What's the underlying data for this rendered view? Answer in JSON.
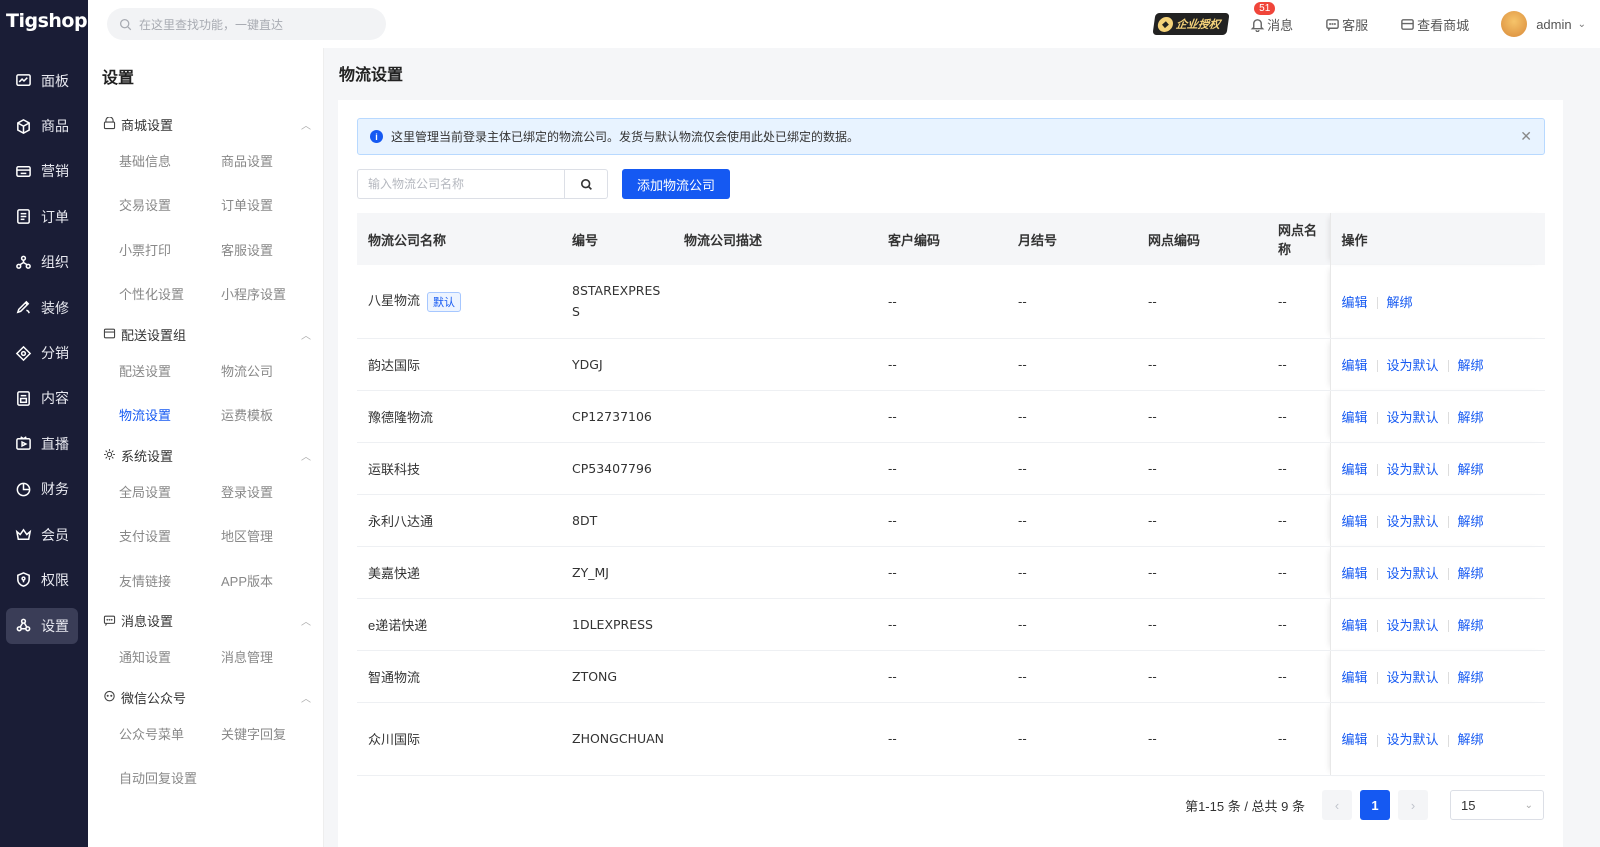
{
  "brand": "Tigshop",
  "nav": [
    {
      "label": "面板",
      "icon": "dashboard-icon"
    },
    {
      "label": "商品",
      "icon": "box-icon"
    },
    {
      "label": "营销",
      "icon": "marketing-icon"
    },
    {
      "label": "订单",
      "icon": "order-icon"
    },
    {
      "label": "组织",
      "icon": "org-icon"
    },
    {
      "label": "装修",
      "icon": "decorate-icon"
    },
    {
      "label": "分销",
      "icon": "distribution-icon"
    },
    {
      "label": "内容",
      "icon": "content-icon"
    },
    {
      "label": "直播",
      "icon": "live-icon"
    },
    {
      "label": "财务",
      "icon": "finance-icon"
    },
    {
      "label": "会员",
      "icon": "member-icon"
    },
    {
      "label": "权限",
      "icon": "permission-icon"
    },
    {
      "label": "设置",
      "icon": "settings-icon",
      "active": true
    }
  ],
  "topbar": {
    "search_placeholder": "在这里查找功能，一键直达",
    "auth_badge": "企业授权",
    "messages_label": "消息",
    "messages_count": "51",
    "service_label": "客服",
    "shop_label": "查看商城",
    "username": "admin"
  },
  "submenu": {
    "title": "设置",
    "groups": [
      {
        "label": "商城设置",
        "items": [
          "基础信息",
          "商品设置",
          "交易设置",
          "订单设置",
          "小票打印",
          "客服设置",
          "个性化设置",
          "小程序设置"
        ]
      },
      {
        "label": "配送设置组",
        "items": [
          "配送设置",
          "物流公司",
          "物流设置",
          "运费模板"
        ],
        "active": "物流设置"
      },
      {
        "label": "系统设置",
        "items": [
          "全局设置",
          "登录设置",
          "支付设置",
          "地区管理",
          "友情链接",
          "APP版本"
        ]
      },
      {
        "label": "消息设置",
        "items": [
          "通知设置",
          "消息管理"
        ]
      },
      {
        "label": "微信公众号",
        "items": [
          "公众号菜单",
          "关键字回复",
          "自动回复设置"
        ]
      }
    ]
  },
  "page": {
    "title": "物流设置",
    "alert": "这里管理当前登录主体已绑定的物流公司。发货与默认物流仅会使用此处已绑定的数据。",
    "keyword_placeholder": "输入物流公司名称",
    "add_button": "添加物流公司"
  },
  "table": {
    "columns": [
      "物流公司名称",
      "编号",
      "物流公司描述",
      "客户编码",
      "月结号",
      "网点编码",
      "网点名称",
      "操作"
    ],
    "default_tag": "默认",
    "actions": {
      "edit": "编辑",
      "set_default": "设为默认",
      "unbind": "解绑"
    },
    "rows": [
      {
        "name": "八星物流",
        "code": "8STAREXPRESS",
        "desc": "",
        "customer": "--",
        "monthly": "--",
        "site_code": "--",
        "site_name": "--",
        "is_default": true
      },
      {
        "name": "韵达国际",
        "code": "YDGJ",
        "desc": "",
        "customer": "--",
        "monthly": "--",
        "site_code": "--",
        "site_name": "--",
        "is_default": false
      },
      {
        "name": "豫德隆物流",
        "code": "CP12737106",
        "desc": "",
        "customer": "--",
        "monthly": "--",
        "site_code": "--",
        "site_name": "--",
        "is_default": false
      },
      {
        "name": "运联科技",
        "code": "CP53407796",
        "desc": "",
        "customer": "--",
        "monthly": "--",
        "site_code": "--",
        "site_name": "--",
        "is_default": false
      },
      {
        "name": "永利八达通",
        "code": "8DT",
        "desc": "",
        "customer": "--",
        "monthly": "--",
        "site_code": "--",
        "site_name": "--",
        "is_default": false
      },
      {
        "name": "美嘉快递",
        "code": "ZY_MJ",
        "desc": "",
        "customer": "--",
        "monthly": "--",
        "site_code": "--",
        "site_name": "--",
        "is_default": false
      },
      {
        "name": "e递诺快递",
        "code": "1DLEXPRESS",
        "desc": "",
        "customer": "--",
        "monthly": "--",
        "site_code": "--",
        "site_name": "--",
        "is_default": false
      },
      {
        "name": "智通物流",
        "code": "ZTONG",
        "desc": "",
        "customer": "--",
        "monthly": "--",
        "site_code": "--",
        "site_name": "--",
        "is_default": false
      },
      {
        "name": "众川国际",
        "code": "ZHONGCHUAN",
        "desc": "",
        "customer": "--",
        "monthly": "--",
        "site_code": "--",
        "site_name": "--",
        "is_default": false
      }
    ]
  },
  "pagination": {
    "summary": "第1-15 条 / 总共 9 条",
    "current_page": "1",
    "page_size": "15",
    "prev_icon": "chevron-left-icon",
    "next_icon": "chevron-right-icon"
  },
  "colors": {
    "primary": "#1559f2",
    "sidebar": "#1a1d36",
    "badge": "#f0453a"
  }
}
